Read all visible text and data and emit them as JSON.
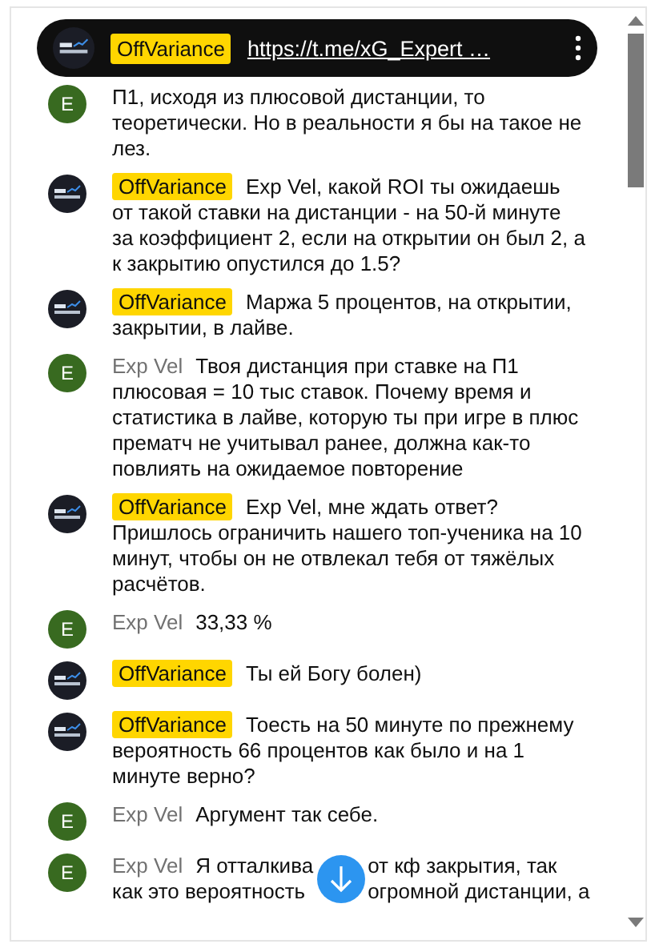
{
  "pinned": {
    "author": "OffVariance",
    "link": "https://t.me/xG_Expert …"
  },
  "messages": [
    {
      "kind": "partial",
      "avatar_letter": "E",
      "text": "П1, исходя из плюсовой дистанции, то теоретически. Но в реальности я бы на такое не лез."
    },
    {
      "kind": "owner",
      "author": "OffVariance",
      "text": "Exp Vel, какой ROI ты ожидаешь от такой ставки на дистанции - на 50-й минуте за коэффициент 2, если на открытии он был 2, а к закрытию опустился до 1.5?"
    },
    {
      "kind": "owner",
      "author": "OffVariance",
      "text": "Маржа 5 процентов, на открытии, закрытии, в лайве."
    },
    {
      "kind": "user",
      "avatar_letter": "E",
      "author": "Exp Vel",
      "text": "Твоя дистанция при ставке на П1 плюсовая = 10 тыс ставок. Почему время и статистика в лайве, которую ты при игре в плюс прематч не учитывал ранее, должна как-то повлиять на ожидаемое повторение"
    },
    {
      "kind": "owner",
      "author": "OffVariance",
      "text": "Exp Vel, мне ждать ответ? Пришлось ограничить нашего топ-ученика на 10 минут, чтобы он не отвлекал тебя от тяжёлых расчётов."
    },
    {
      "kind": "user",
      "avatar_letter": "E",
      "author": "Exp Vel",
      "text": "33,33 %"
    },
    {
      "kind": "owner",
      "author": "OffVariance",
      "text": "Ты ей Богу болен)"
    },
    {
      "kind": "owner",
      "author": "OffVariance",
      "text": "Тоесть на 50 минуте по прежнему вероятность 66 процентов как было и на 1 минуте верно?"
    },
    {
      "kind": "user",
      "avatar_letter": "E",
      "author": "Exp Vel",
      "text": "Аргумент так себе."
    },
    {
      "kind": "covered",
      "avatar_letter": "E",
      "author": "Exp Vel",
      "lines": [
        [
          "Я отталкива",
          "от кф закрытия, так"
        ],
        [
          "как это вероятность",
          "огромной дистанции, а"
        ]
      ]
    }
  ]
}
